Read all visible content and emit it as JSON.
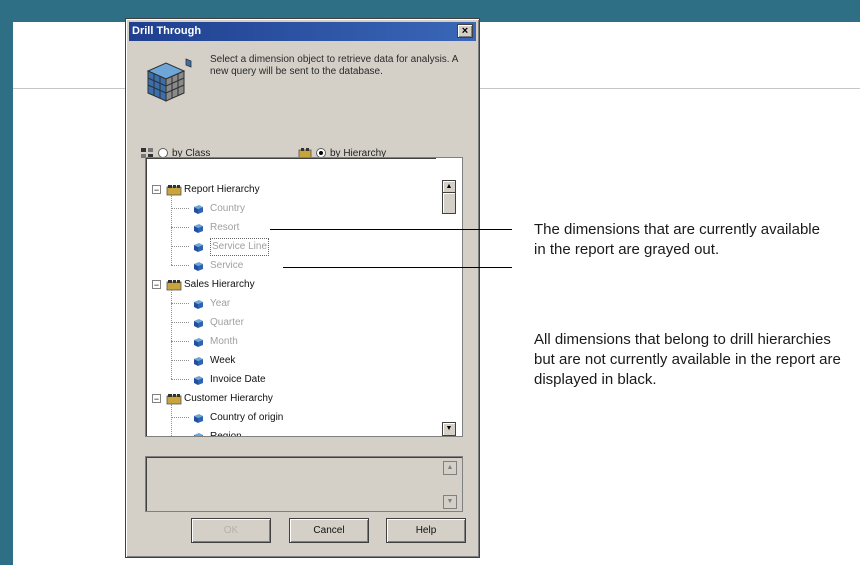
{
  "dialog": {
    "title": "Drill Through",
    "close_glyph": "×",
    "intro_text": "Select a dimension object to retrieve data for analysis. A new query will be sent to the database.",
    "radio_by_class": "by Class",
    "radio_by_hierarchy": "by Hierarchy",
    "selected_radio": "by Hierarchy",
    "tree": [
      {
        "label": "Report Hierarchy",
        "level": 0,
        "state": "parent"
      },
      {
        "label": "Country",
        "level": 1,
        "state": "grayed"
      },
      {
        "label": "Resort",
        "level": 1,
        "state": "grayed"
      },
      {
        "label": "Service Line",
        "level": 1,
        "state": "grayed"
      },
      {
        "label": "Service",
        "level": 1,
        "state": "grayed"
      },
      {
        "label": "Sales Hierarchy",
        "level": 0,
        "state": "parent"
      },
      {
        "label": "Year",
        "level": 1,
        "state": "grayed"
      },
      {
        "label": "Quarter",
        "level": 1,
        "state": "grayed"
      },
      {
        "label": "Month",
        "level": 1,
        "state": "grayed"
      },
      {
        "label": "Week",
        "level": 1,
        "state": "black"
      },
      {
        "label": "Invoice Date",
        "level": 1,
        "state": "black"
      },
      {
        "label": "Customer Hierarchy",
        "level": 0,
        "state": "parent"
      },
      {
        "label": "Country of origin",
        "level": 1,
        "state": "black"
      },
      {
        "label": "Region",
        "level": 1,
        "state": "black"
      }
    ],
    "buttons": {
      "ok": "OK",
      "cancel": "Cancel",
      "help": "Help"
    }
  },
  "annotations": {
    "grayed": "The dimensions that are currently available in the report are grayed out.",
    "black": "All dimensions that belong to drill hierarchies but are not currently available in the report are displayed in black."
  },
  "colors": {
    "slide_band": "#2e6f86",
    "title_bar": "#1f3f8f",
    "dialog_face": "#d4d0c8",
    "grayed_text": "#a0a0a0",
    "black_text": "#111111"
  },
  "icons": {
    "intro": "cube-icon",
    "by_class": "class-icon",
    "by_hierarchy": "hierarchy-icon",
    "parent": "folder-icon",
    "dimension": "dimension-icon"
  }
}
